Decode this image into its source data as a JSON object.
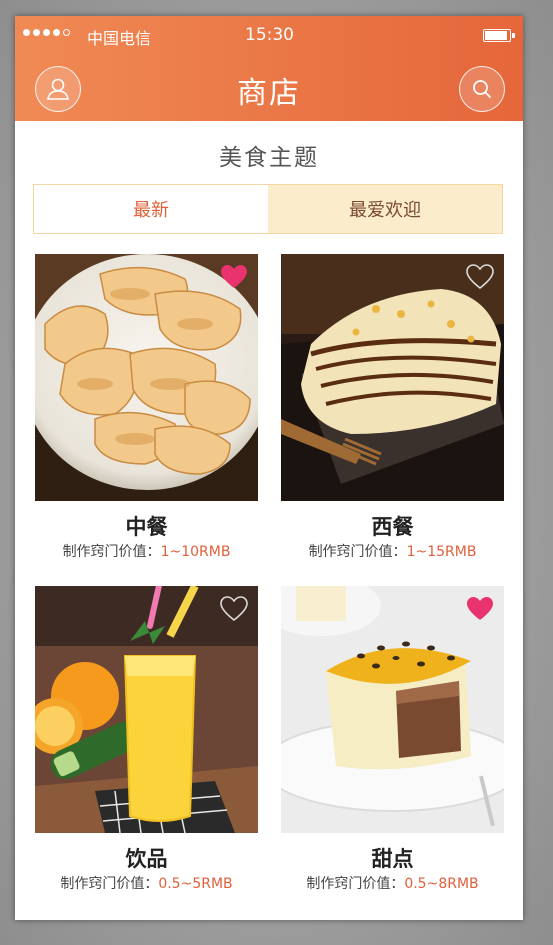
{
  "status_bar": {
    "carrier": "中国电信",
    "time": "15:30"
  },
  "nav": {
    "title": "商店",
    "left_icon": "user-icon",
    "right_icon": "search-icon"
  },
  "section_title": "美食主题",
  "tabs": [
    {
      "label": "最新",
      "active": false
    },
    {
      "label": "最爱欢迎",
      "active": true
    }
  ],
  "cards": [
    {
      "name": "中餐",
      "meta_label": "制作窍门价值：",
      "meta_value": "1~10RMB",
      "favorited": true,
      "image": "dumplings"
    },
    {
      "name": "西餐",
      "meta_label": "制作窍门价值：",
      "meta_value": "1~15RMB",
      "favorited": false,
      "image": "chocolate-dessert"
    },
    {
      "name": "饮品",
      "meta_label": "制作窍门价值：",
      "meta_value": "0.5~5RMB",
      "favorited": false,
      "image": "juice"
    },
    {
      "name": "甜点",
      "meta_label": "制作窍门价值：",
      "meta_value": "0.5~8RMB",
      "favorited": true,
      "image": "mousse-cake"
    }
  ],
  "colors": {
    "accent": "#e5663a",
    "heart_active": "#e8336e",
    "tab_active_bg": "#fbeccc"
  }
}
